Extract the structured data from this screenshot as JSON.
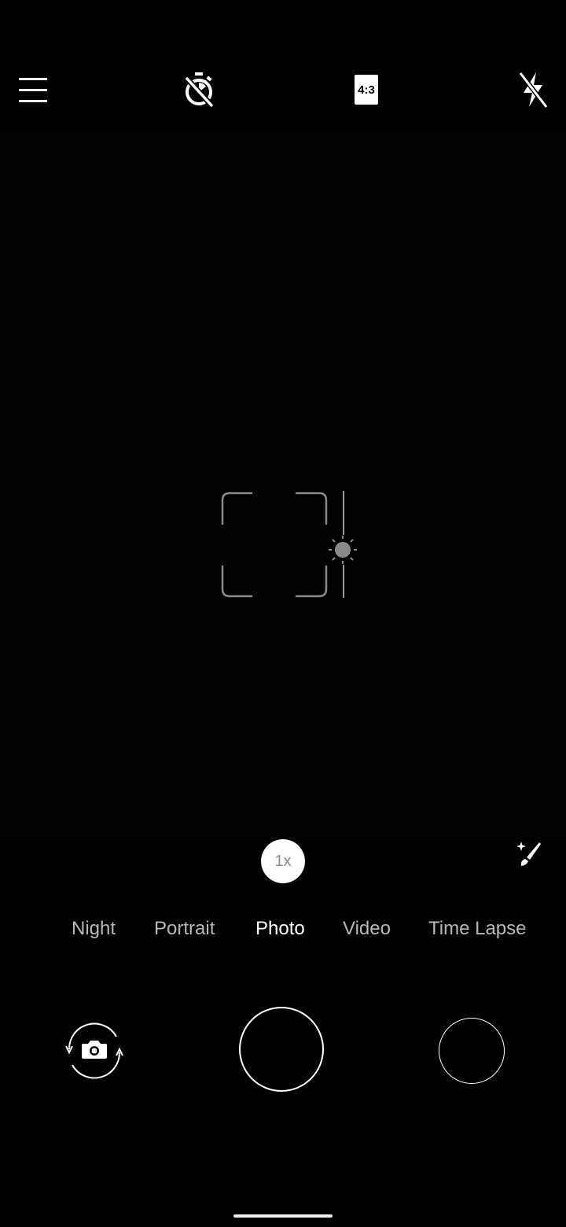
{
  "top_bar": {
    "menu_icon": "hamburger-menu-icon",
    "timer_icon": "timer-off-icon",
    "aspect_ratio": "4:3",
    "flash_icon": "flash-off-icon"
  },
  "viewfinder": {
    "focus_icon": "focus-bracket-icon",
    "exposure_icon": "exposure-sun-icon"
  },
  "zoom": {
    "label": "1x"
  },
  "filter_icon": "magic-wand-icon",
  "modes": [
    {
      "label": "Night",
      "active": false
    },
    {
      "label": "Portrait",
      "active": false
    },
    {
      "label": "Photo",
      "active": true
    },
    {
      "label": "Video",
      "active": false
    },
    {
      "label": "Time Lapse",
      "active": false
    }
  ],
  "controls": {
    "switch_camera_icon": "switch-camera-icon",
    "shutter_icon": "shutter-button",
    "gallery_icon": "gallery-thumbnail"
  },
  "colors": {
    "background": "#000000",
    "active_mode": "#ffffff",
    "inactive_mode": "#b8b8b8",
    "focus_frame": "#8a8a8a"
  }
}
